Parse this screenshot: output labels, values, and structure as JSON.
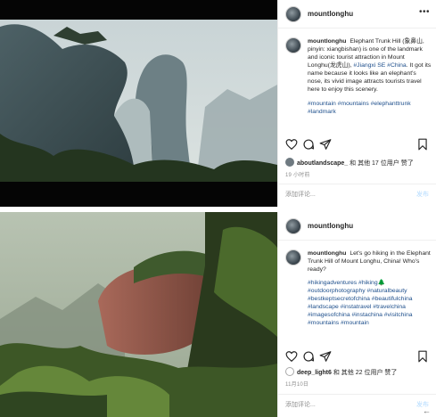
{
  "posts": [
    {
      "username": "mountlonghu",
      "more": "•••",
      "caption_user": "mountlonghu",
      "caption_text": "Elephant Trunk Hill (象鼻山, pinyin: xiangbishan) is one of the landmark and iconic tourist attraction in Mount Longhu(龙虎山),",
      "caption_tags_inline": "#Jiangxi SE #China",
      "caption_text_2": ". It got its name because it looks like an elephant's nose, its vivid image attracts tourists travel here to enjoy this scenery.",
      "tags": "#mountain #mountains #elephanttrunk #landmark",
      "liker": "aboutlandscape_",
      "likes_text": " 和 其他 17 位用户 赞了",
      "date": "19 小时前",
      "comment_placeholder": "添加评论...",
      "post_label": "发布"
    },
    {
      "username": "mountlonghu",
      "more": "",
      "caption_user": "mountlonghu",
      "caption_text": "Let's go hiking in the Elephant Trunk Hill of Mount Longhu, China! Who's ready?",
      "tags": "#hikingadventures #hiking🌲 #outdoorphotography #naturalbeauty #bestkeptsecretofchina #beautifulchina #landscape #instatravel #travelchina #imagesofchina #instachina #visitchina #mountains #mountain",
      "liker": "deep_light6",
      "likes_text": " 和 其他 22 位用户 赞了",
      "date": "11月10日",
      "comment_placeholder": "添加评论...",
      "post_label": "发布"
    }
  ],
  "icons": {
    "like": "heart-icon",
    "comment": "speech-bubble-icon",
    "share": "paper-plane-icon",
    "save": "bookmark-icon"
  }
}
